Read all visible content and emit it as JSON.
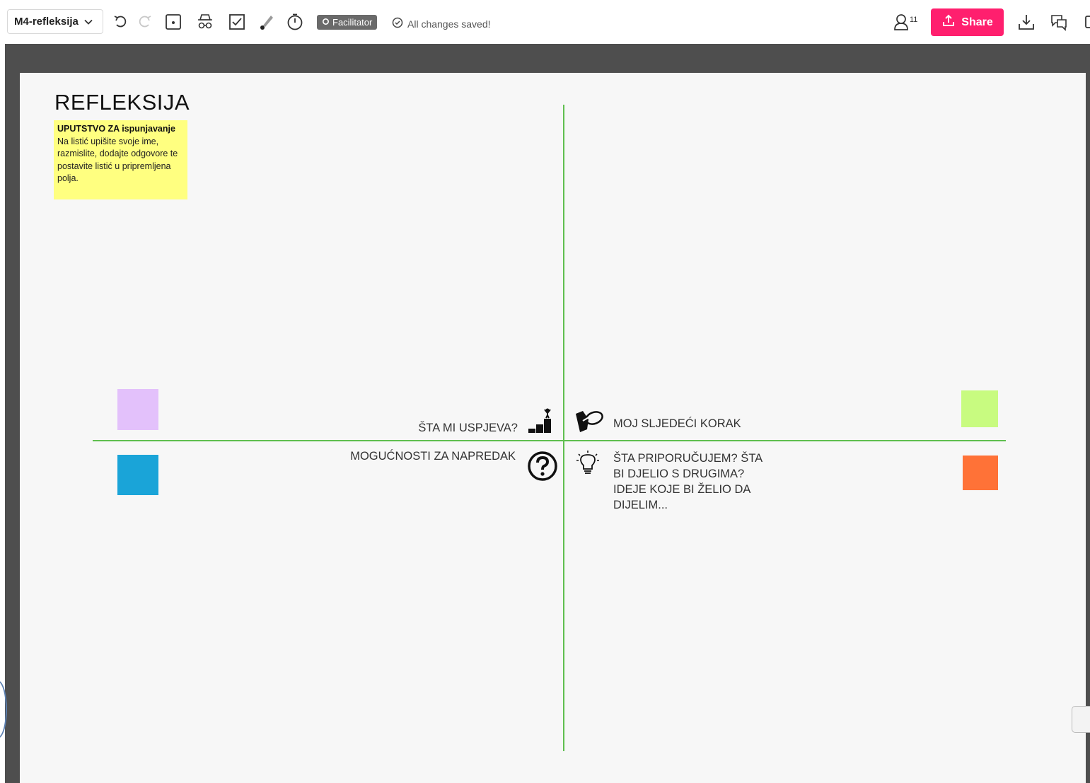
{
  "toolbar": {
    "board_name": "M4-refleksija",
    "facilitator_label": "Facilitator",
    "save_status": "All changes saved!",
    "user_count": "11",
    "share_label": "Share",
    "icons": [
      "chevron-down-icon",
      "undo-icon",
      "redo-icon",
      "sticky-note-icon",
      "anonymous-mode-icon",
      "voting-icon",
      "highlighter-icon",
      "timer-icon",
      "gear-icon",
      "check-circle-icon",
      "user-icon",
      "upload-icon",
      "download-icon",
      "comments-icon",
      "panel-icon"
    ]
  },
  "board": {
    "title": "REFLEKSIJA",
    "instructions": {
      "heading": "UPUTSTVO ZA ispunjavanje",
      "body": "Na listić upišite svoje ime, razmislite, dodajte odgovore te postavite listić u pripremljena polja."
    },
    "quadrants": {
      "top_left": "ŠTA MI USPJEVA?",
      "top_right": "MOJ SLJEDEĆI KORAK",
      "bottom_left": "MOGUĆNOSTI ZA NAPREDAK",
      "bottom_right": "ŠTA PRIPORUČUJEM? ŠTA BI DJELIO S DRUGIMA? IDEJE KOJE BI ŽELIO DA DIJELIM..."
    },
    "sticky_colors": {
      "top_left": "#e3c1fb",
      "bottom_left": "#1aa4d8",
      "top_right": "#c8fb80",
      "bottom_right": "#ff7237"
    },
    "line_color": "#5fbf4f",
    "note_color": "#ffff80"
  }
}
